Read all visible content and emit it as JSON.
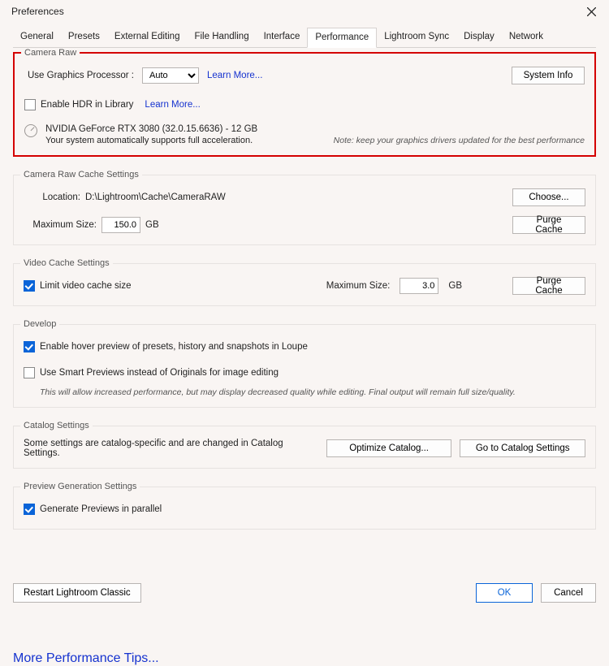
{
  "window": {
    "title": "Preferences"
  },
  "tabs": [
    "General",
    "Presets",
    "External Editing",
    "File Handling",
    "Interface",
    "Performance",
    "Lightroom Sync",
    "Display",
    "Network"
  ],
  "activeTab": "Performance",
  "cameraRaw": {
    "title": "Camera Raw",
    "gpuLabel": "Use Graphics Processor :",
    "gpuValue": "Auto",
    "gpuLearnMore": "Learn More...",
    "systemInfo": "System Info",
    "enableHdrLabel": "Enable HDR in Library",
    "hdrLearnMore": "Learn More...",
    "gpuName": "NVIDIA GeForce RTX 3080 (32.0.15.6636) - 12 GB",
    "gpuNote": "Your system automatically supports full acceleration.",
    "driverNote": "Note: keep your graphics drivers updated for the best performance"
  },
  "cache": {
    "title": "Camera Raw Cache Settings",
    "locationLabel": "Location:",
    "locationValue": "D:\\Lightroom\\Cache\\CameraRAW",
    "choose": "Choose...",
    "maxSizeLabel": "Maximum Size:",
    "maxSizeValue": "150.0",
    "maxSizeUnit": "GB",
    "purge": "Purge Cache"
  },
  "video": {
    "title": "Video Cache Settings",
    "limitLabel": "Limit video cache size",
    "maxSizeLabel": "Maximum Size:",
    "maxSizeValue": "3.0",
    "maxSizeUnit": "GB",
    "purge": "Purge Cache"
  },
  "develop": {
    "title": "Develop",
    "hoverPreview": "Enable hover preview of presets, history and snapshots in Loupe",
    "smartPreviews": "Use Smart Previews instead of Originals for image editing",
    "smartNote": "This will allow increased performance, but may display decreased quality while editing. Final output will remain full size/quality."
  },
  "catalog": {
    "title": "Catalog Settings",
    "desc": "Some settings are catalog-specific and are changed in Catalog Settings.",
    "optimize": "Optimize Catalog...",
    "goTo": "Go to Catalog Settings"
  },
  "preview": {
    "title": "Preview Generation Settings",
    "parallel": "Generate Previews in parallel"
  },
  "moreTips": "More Performance Tips...",
  "footer": {
    "restart": "Restart Lightroom Classic",
    "ok": "OK",
    "cancel": "Cancel"
  }
}
